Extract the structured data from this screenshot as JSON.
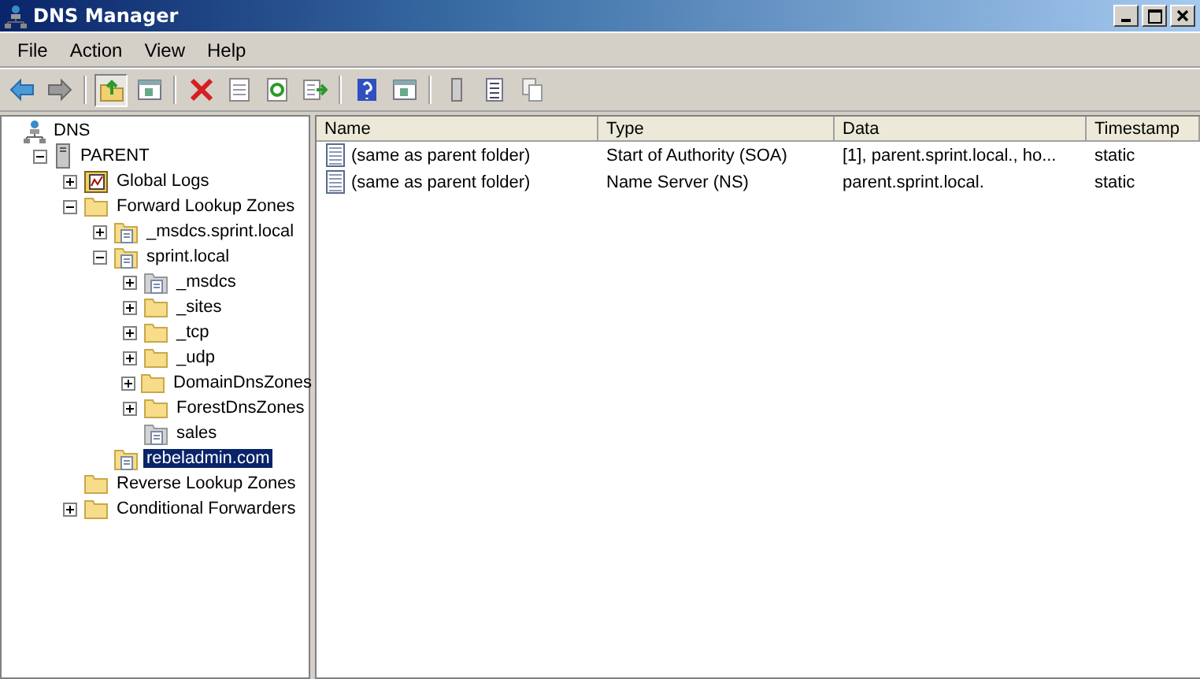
{
  "window": {
    "title": "DNS Manager"
  },
  "menu": [
    "File",
    "Action",
    "View",
    "Help"
  ],
  "toolbar": [
    {
      "kind": "back"
    },
    {
      "kind": "forward"
    },
    {
      "kind": "sep"
    },
    {
      "kind": "up",
      "selected": true
    },
    {
      "kind": "pane",
      "selected": false
    },
    {
      "kind": "sep"
    },
    {
      "kind": "delete"
    },
    {
      "kind": "properties"
    },
    {
      "kind": "refresh"
    },
    {
      "kind": "export"
    },
    {
      "kind": "sep"
    },
    {
      "kind": "help"
    },
    {
      "kind": "pane"
    },
    {
      "kind": "sep"
    },
    {
      "kind": "server"
    },
    {
      "kind": "list"
    },
    {
      "kind": "copy"
    }
  ],
  "tree": [
    {
      "label": "DNS",
      "kind": "dns",
      "selected": false,
      "children": [
        {
          "label": "PARENT",
          "kind": "server",
          "expanded": true,
          "selected": false,
          "children": [
            {
              "label": "Global Logs",
              "kind": "log",
              "expanded": false,
              "selected": false
            },
            {
              "label": "Forward Lookup Zones",
              "kind": "folder",
              "expanded": true,
              "selected": false,
              "children": [
                {
                  "label": "_msdcs.sprint.local",
                  "kind": "zone",
                  "expanded": false,
                  "selected": false
                },
                {
                  "label": "sprint.local",
                  "kind": "zone",
                  "expanded": true,
                  "selected": false,
                  "children": [
                    {
                      "label": "_msdcs",
                      "kind": "zone-grey",
                      "expanded": false,
                      "selected": false
                    },
                    {
                      "label": "_sites",
                      "kind": "folder",
                      "expanded": false,
                      "selected": false
                    },
                    {
                      "label": "_tcp",
                      "kind": "folder",
                      "expanded": false,
                      "selected": false
                    },
                    {
                      "label": "_udp",
                      "kind": "folder",
                      "expanded": false,
                      "selected": false
                    },
                    {
                      "label": "DomainDnsZones",
                      "kind": "folder",
                      "expanded": false,
                      "selected": false
                    },
                    {
                      "label": "ForestDnsZones",
                      "kind": "folder",
                      "expanded": false,
                      "selected": false
                    },
                    {
                      "label": "sales",
                      "kind": "zone-grey",
                      "selected": false
                    }
                  ]
                },
                {
                  "label": "rebeladmin.com",
                  "kind": "zone",
                  "selected": true
                }
              ]
            },
            {
              "label": "Reverse Lookup Zones",
              "kind": "folder",
              "selected": false
            },
            {
              "label": "Conditional Forwarders",
              "kind": "folder",
              "expanded": false,
              "selected": false
            }
          ]
        }
      ]
    }
  ],
  "table": {
    "columns": [
      "Name",
      "Type",
      "Data",
      "Timestamp"
    ],
    "rows": [
      {
        "cells": [
          "(same as parent folder)",
          "Start of Authority (SOA)",
          "[1], parent.sprint.local., ho...",
          "static"
        ]
      },
      {
        "cells": [
          "(same as parent folder)",
          "Name Server (NS)",
          "parent.sprint.local.",
          "static"
        ]
      }
    ]
  }
}
